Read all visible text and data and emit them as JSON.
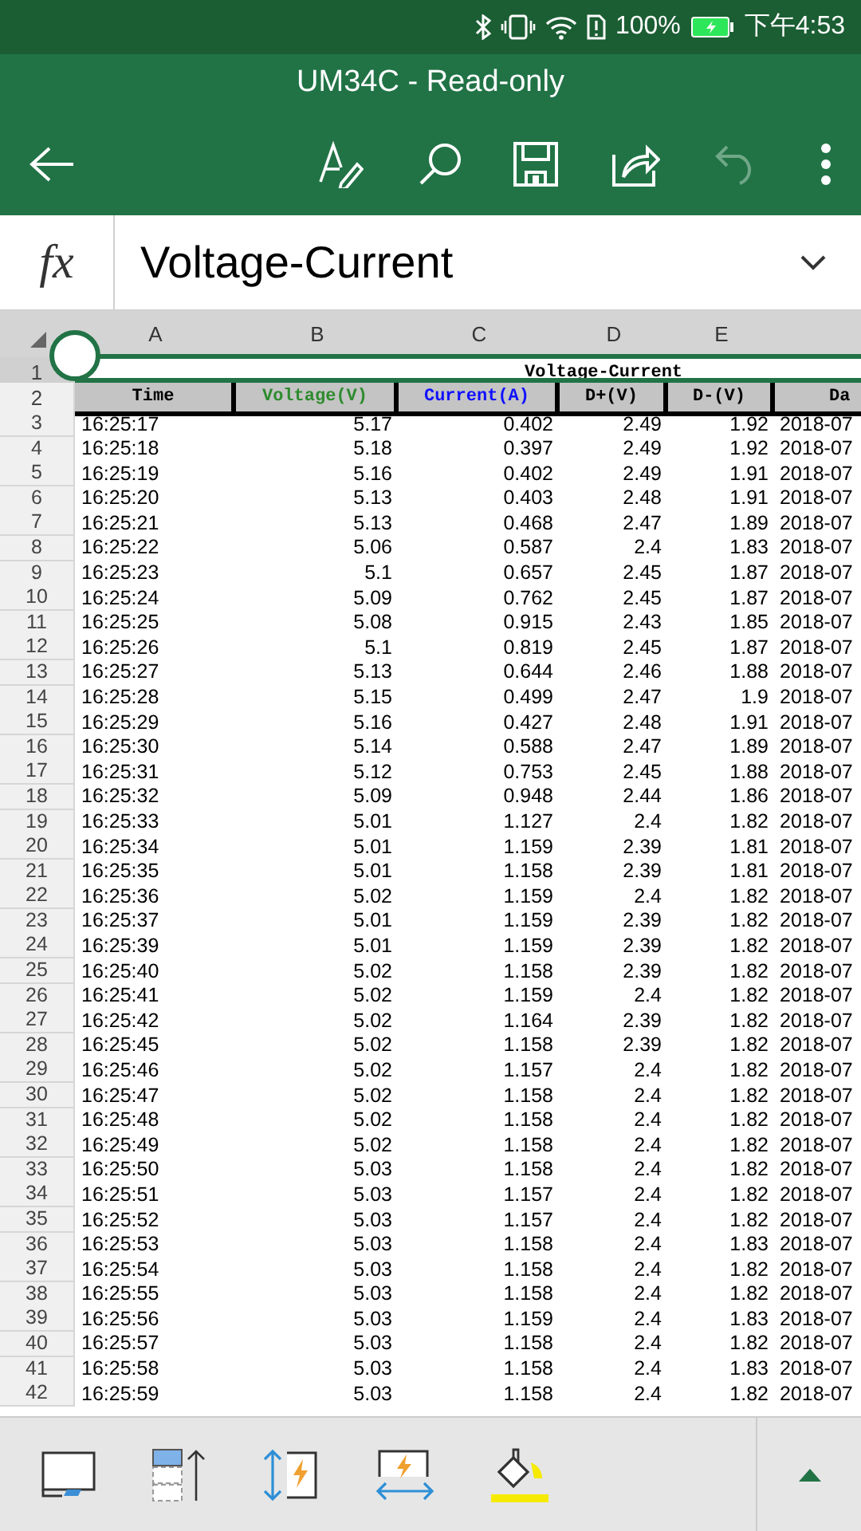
{
  "status_bar": {
    "battery": "100%",
    "time": "下午4:53"
  },
  "window": {
    "title": "UM34C - Read-only"
  },
  "toolbar": {
    "undo": {
      "disabled": true
    }
  },
  "formula_bar": {
    "label": "fx",
    "value": "Voltage-Current"
  },
  "columns": [
    "A",
    "B",
    "C",
    "D",
    "E"
  ],
  "sheet": {
    "title_row": "1",
    "title": "Voltage-Current",
    "header_row": "2",
    "headers": [
      {
        "text": "Time",
        "color": "#000000"
      },
      {
        "text": "Voltage(V)",
        "color": "#2e8b2e"
      },
      {
        "text": "Current(A)",
        "color": "#1010ff"
      },
      {
        "text": "D+(V)",
        "color": "#000000"
      },
      {
        "text": "D-(V)",
        "color": "#000000"
      },
      {
        "text": "Da",
        "color": "#000000"
      }
    ],
    "rows": [
      {
        "n": "3",
        "cells": [
          "16:25:17",
          "5.17",
          "0.402",
          "2.49",
          "1.92",
          "2018-07"
        ]
      },
      {
        "n": "4",
        "cells": [
          "16:25:18",
          "5.18",
          "0.397",
          "2.49",
          "1.92",
          "2018-07"
        ]
      },
      {
        "n": "5",
        "cells": [
          "16:25:19",
          "5.16",
          "0.402",
          "2.49",
          "1.91",
          "2018-07"
        ]
      },
      {
        "n": "6",
        "cells": [
          "16:25:20",
          "5.13",
          "0.403",
          "2.48",
          "1.91",
          "2018-07"
        ]
      },
      {
        "n": "7",
        "cells": [
          "16:25:21",
          "5.13",
          "0.468",
          "2.47",
          "1.89",
          "2018-07"
        ]
      },
      {
        "n": "8",
        "cells": [
          "16:25:22",
          "5.06",
          "0.587",
          "2.4",
          "1.83",
          "2018-07"
        ]
      },
      {
        "n": "9",
        "cells": [
          "16:25:23",
          "5.1",
          "0.657",
          "2.45",
          "1.87",
          "2018-07"
        ]
      },
      {
        "n": "10",
        "cells": [
          "16:25:24",
          "5.09",
          "0.762",
          "2.45",
          "1.87",
          "2018-07"
        ]
      },
      {
        "n": "11",
        "cells": [
          "16:25:25",
          "5.08",
          "0.915",
          "2.43",
          "1.85",
          "2018-07"
        ]
      },
      {
        "n": "12",
        "cells": [
          "16:25:26",
          "5.1",
          "0.819",
          "2.45",
          "1.87",
          "2018-07"
        ]
      },
      {
        "n": "13",
        "cells": [
          "16:25:27",
          "5.13",
          "0.644",
          "2.46",
          "1.88",
          "2018-07"
        ]
      },
      {
        "n": "14",
        "cells": [
          "16:25:28",
          "5.15",
          "0.499",
          "2.47",
          "1.9",
          "2018-07"
        ]
      },
      {
        "n": "15",
        "cells": [
          "16:25:29",
          "5.16",
          "0.427",
          "2.48",
          "1.91",
          "2018-07"
        ]
      },
      {
        "n": "16",
        "cells": [
          "16:25:30",
          "5.14",
          "0.588",
          "2.47",
          "1.89",
          "2018-07"
        ]
      },
      {
        "n": "17",
        "cells": [
          "16:25:31",
          "5.12",
          "0.753",
          "2.45",
          "1.88",
          "2018-07"
        ]
      },
      {
        "n": "18",
        "cells": [
          "16:25:32",
          "5.09",
          "0.948",
          "2.44",
          "1.86",
          "2018-07"
        ]
      },
      {
        "n": "19",
        "cells": [
          "16:25:33",
          "5.01",
          "1.127",
          "2.4",
          "1.82",
          "2018-07"
        ]
      },
      {
        "n": "20",
        "cells": [
          "16:25:34",
          "5.01",
          "1.159",
          "2.39",
          "1.81",
          "2018-07"
        ]
      },
      {
        "n": "21",
        "cells": [
          "16:25:35",
          "5.01",
          "1.158",
          "2.39",
          "1.81",
          "2018-07"
        ]
      },
      {
        "n": "22",
        "cells": [
          "16:25:36",
          "5.02",
          "1.159",
          "2.4",
          "1.82",
          "2018-07"
        ]
      },
      {
        "n": "23",
        "cells": [
          "16:25:37",
          "5.01",
          "1.159",
          "2.39",
          "1.82",
          "2018-07"
        ]
      },
      {
        "n": "24",
        "cells": [
          "16:25:39",
          "5.01",
          "1.159",
          "2.39",
          "1.82",
          "2018-07"
        ]
      },
      {
        "n": "25",
        "cells": [
          "16:25:40",
          "5.02",
          "1.158",
          "2.39",
          "1.82",
          "2018-07"
        ]
      },
      {
        "n": "26",
        "cells": [
          "16:25:41",
          "5.02",
          "1.159",
          "2.4",
          "1.82",
          "2018-07"
        ]
      },
      {
        "n": "27",
        "cells": [
          "16:25:42",
          "5.02",
          "1.164",
          "2.39",
          "1.82",
          "2018-07"
        ]
      },
      {
        "n": "28",
        "cells": [
          "16:25:45",
          "5.02",
          "1.158",
          "2.39",
          "1.82",
          "2018-07"
        ]
      },
      {
        "n": "29",
        "cells": [
          "16:25:46",
          "5.02",
          "1.157",
          "2.4",
          "1.82",
          "2018-07"
        ]
      },
      {
        "n": "30",
        "cells": [
          "16:25:47",
          "5.02",
          "1.158",
          "2.4",
          "1.82",
          "2018-07"
        ]
      },
      {
        "n": "31",
        "cells": [
          "16:25:48",
          "5.02",
          "1.158",
          "2.4",
          "1.82",
          "2018-07"
        ]
      },
      {
        "n": "32",
        "cells": [
          "16:25:49",
          "5.02",
          "1.158",
          "2.4",
          "1.82",
          "2018-07"
        ]
      },
      {
        "n": "33",
        "cells": [
          "16:25:50",
          "5.03",
          "1.158",
          "2.4",
          "1.82",
          "2018-07"
        ]
      },
      {
        "n": "34",
        "cells": [
          "16:25:51",
          "5.03",
          "1.157",
          "2.4",
          "1.82",
          "2018-07"
        ]
      },
      {
        "n": "35",
        "cells": [
          "16:25:52",
          "5.03",
          "1.157",
          "2.4",
          "1.82",
          "2018-07"
        ]
      },
      {
        "n": "36",
        "cells": [
          "16:25:53",
          "5.03",
          "1.158",
          "2.4",
          "1.83",
          "2018-07"
        ]
      },
      {
        "n": "37",
        "cells": [
          "16:25:54",
          "5.03",
          "1.158",
          "2.4",
          "1.82",
          "2018-07"
        ]
      },
      {
        "n": "38",
        "cells": [
          "16:25:55",
          "5.03",
          "1.158",
          "2.4",
          "1.82",
          "2018-07"
        ]
      },
      {
        "n": "39",
        "cells": [
          "16:25:56",
          "5.03",
          "1.159",
          "2.4",
          "1.83",
          "2018-07"
        ]
      },
      {
        "n": "40",
        "cells": [
          "16:25:57",
          "5.03",
          "1.158",
          "2.4",
          "1.82",
          "2018-07"
        ]
      },
      {
        "n": "41",
        "cells": [
          "16:25:58",
          "5.03",
          "1.158",
          "2.4",
          "1.83",
          "2018-07"
        ]
      },
      {
        "n": "42",
        "cells": [
          "16:25:59",
          "5.03",
          "1.158",
          "2.4",
          "1.82",
          "2018-07"
        ]
      }
    ]
  }
}
